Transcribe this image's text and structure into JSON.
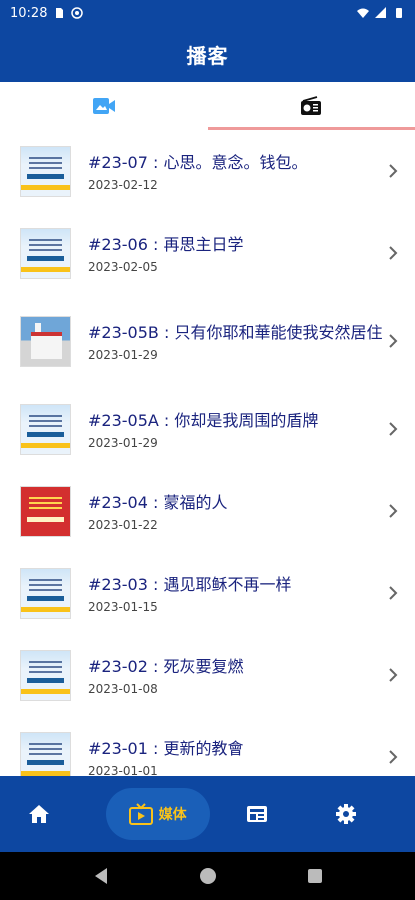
{
  "status": {
    "time": "10:28"
  },
  "app": {
    "title": "播客"
  },
  "tabs": [
    {
      "icon": "video-camera-icon",
      "active": false
    },
    {
      "icon": "radio-icon",
      "active": true
    }
  ],
  "episodes": [
    {
      "title": "#23-07 : 心思。意念。钱包。",
      "date": "2023-02-12",
      "thumb": "bulletin"
    },
    {
      "title": "#23-06 : 再思主日学",
      "date": "2023-02-05",
      "thumb": "bulletin"
    },
    {
      "title": "#23-05B : 只有你耶和華能使我安然居住",
      "date": "2023-01-29",
      "thumb": "church"
    },
    {
      "title": "#23-05A : 你却是我周围的盾牌",
      "date": "2023-01-29",
      "thumb": "bulletin"
    },
    {
      "title": "#23-04 : 蒙福的人",
      "date": "2023-01-22",
      "thumb": "red"
    },
    {
      "title": "#23-03 : 遇见耶稣不再一样",
      "date": "2023-01-15",
      "thumb": "bulletin"
    },
    {
      "title": "#23-02 : 死灰要复燃",
      "date": "2023-01-08",
      "thumb": "bulletin"
    },
    {
      "title": "#23-01 : 更新的教會",
      "date": "2023-01-01",
      "thumb": "bulletin"
    }
  ],
  "bottom_nav": {
    "home_icon": "home-icon",
    "media_label": "媒体",
    "media_icon": "tv-icon",
    "news_icon": "newspaper-icon",
    "settings_icon": "gear-icon"
  },
  "colors": {
    "primary": "#0d47a1",
    "accent": "#f9c21a",
    "title_text": "#1a237e",
    "tab_indicator": "#ef9a9a"
  }
}
